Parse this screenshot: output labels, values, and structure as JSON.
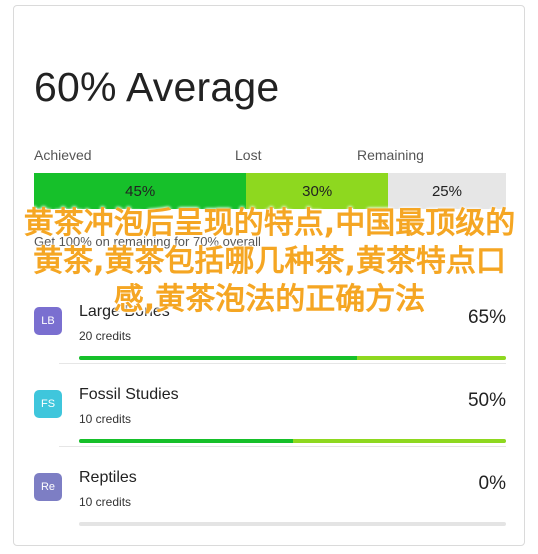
{
  "header": {
    "title": "60% Average"
  },
  "breakdown": {
    "achieved_label": "Achieved",
    "lost_label": "Lost",
    "remaining_label": "Remaining",
    "achieved_value": "45%",
    "lost_value": "30%",
    "remaining_value": "25%",
    "achieved_fraction": 0.45,
    "lost_fraction": 0.3,
    "remaining_fraction": 0.25,
    "colors": {
      "achieved": "#16c02a",
      "lost": "#8ed81f",
      "remaining": "#e6e6e6"
    }
  },
  "note": "Get 100% on remaining for 70% overall",
  "courses": [
    {
      "name": "Large Bones",
      "initials": "LB",
      "credits": "20 credits",
      "percent": "65%",
      "achieved": 0.65,
      "lost": 0.35,
      "avatar_color": "#7a6fd0"
    },
    {
      "name": "Fossil Studies",
      "initials": "FS",
      "credits": "10 credits",
      "percent": "50%",
      "achieved": 0.5,
      "lost": 0.5,
      "avatar_color": "#3fc6dc"
    },
    {
      "name": "Reptiles",
      "initials": "Re",
      "credits": "10 credits",
      "percent": "0%",
      "achieved": 0.0,
      "lost": 0.0,
      "avatar_color": "#7d7ec4"
    }
  ],
  "overlay_text": "黄茶冲泡后呈现的特点,中国最顶级的黄茶,黄茶包括哪几种茶,黄茶特点口感,黄茶泡法的正确方法"
}
